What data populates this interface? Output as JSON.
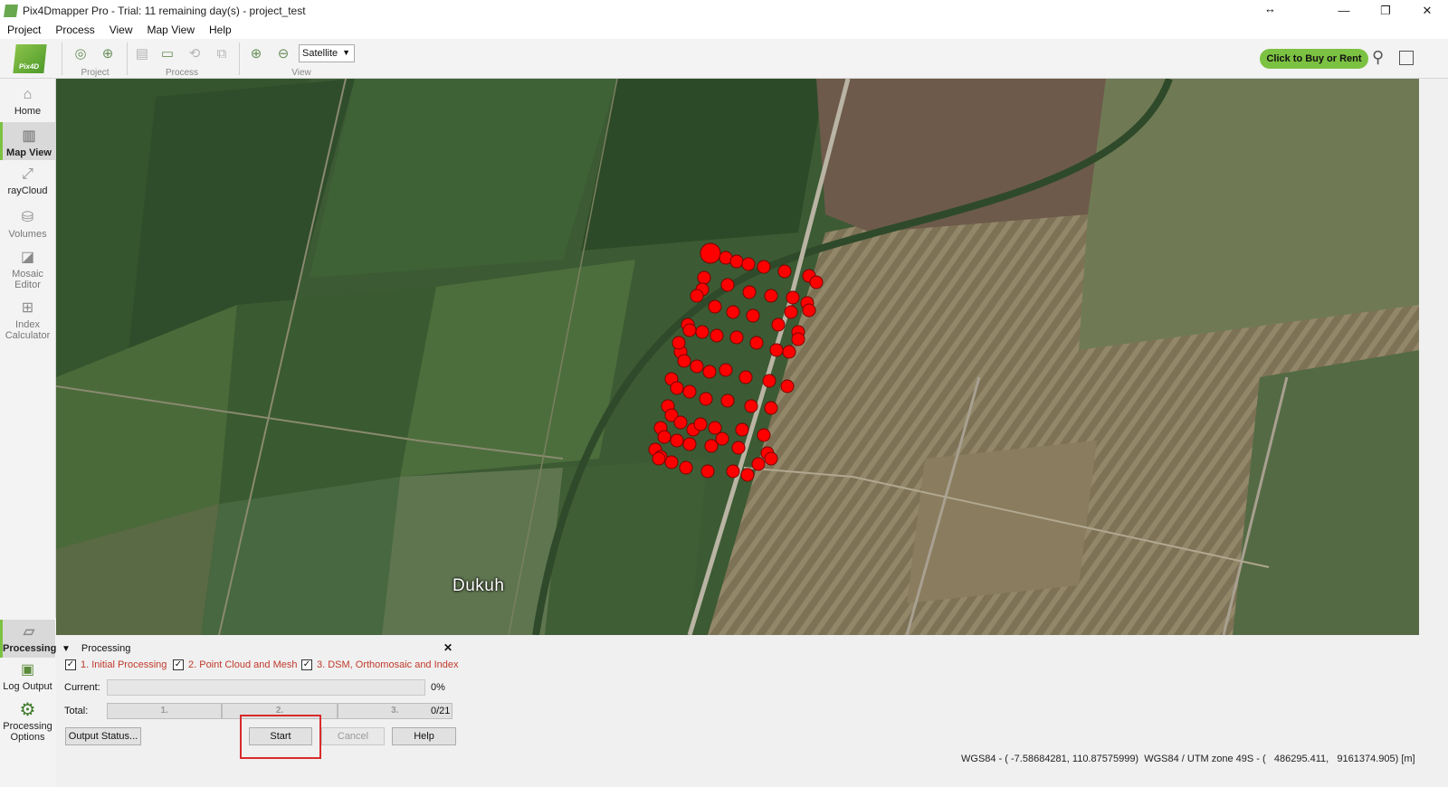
{
  "window": {
    "title": "Pix4Dmapper Pro - Trial: 11 remaining day(s) - project_test",
    "controls": [
      "—",
      "❐",
      "✕"
    ]
  },
  "menu": [
    "Project",
    "Process",
    "View",
    "Map View",
    "Help"
  ],
  "toolbar": {
    "groups": {
      "project": "Project",
      "process": "Process",
      "view": "View"
    },
    "basemap_select": "Satellite",
    "buy_button": "Click to Buy or Rent",
    "logo_text": "Pix4D"
  },
  "sidebar": {
    "items": [
      {
        "label": "Home",
        "icon": "home-icon"
      },
      {
        "label": "Map View",
        "icon": "map-icon"
      },
      {
        "label": "rayCloud",
        "icon": "raycloud-icon"
      },
      {
        "label": "Volumes",
        "icon": "volumes-icon"
      },
      {
        "label": "Mosaic Editor",
        "icon": "mosaic-icon"
      },
      {
        "label": "Index Calculator",
        "icon": "index-icon"
      }
    ],
    "bottom_items": [
      {
        "label": "Processing",
        "icon": "processing-icon"
      },
      {
        "label": "Log Output",
        "icon": "log-icon"
      },
      {
        "label": "Processing Options",
        "icon": "gear-icon"
      }
    ]
  },
  "map": {
    "place_label": "Dukuh",
    "image_count": 21,
    "colors": {
      "marker": "#ff0000",
      "marker_stroke": "#7a0000"
    }
  },
  "processing": {
    "title": "Processing",
    "steps": [
      {
        "label": "1. Initial Processing",
        "checked": true
      },
      {
        "label": "2. Point Cloud and Mesh",
        "checked": true
      },
      {
        "label": "3. DSM, Orthomosaic and Index",
        "checked": true
      }
    ],
    "current_label": "Current:",
    "current_progress": 0,
    "current_text": "0%",
    "total_label": "Total:",
    "total_segments": [
      "1.",
      "2.",
      "3."
    ],
    "total_text": "0/21",
    "buttons": {
      "output_status": "Output Status...",
      "start": "Start",
      "cancel": "Cancel",
      "help": "Help"
    }
  },
  "status_bar": "WGS84 - ( -7.58684281, 110.87575999)  WGS84 / UTM zone 49S - (   486295.411,   9161374.905) [m]",
  "colors": {
    "accent": "#7cc242",
    "highlight": "#d92b2b"
  }
}
